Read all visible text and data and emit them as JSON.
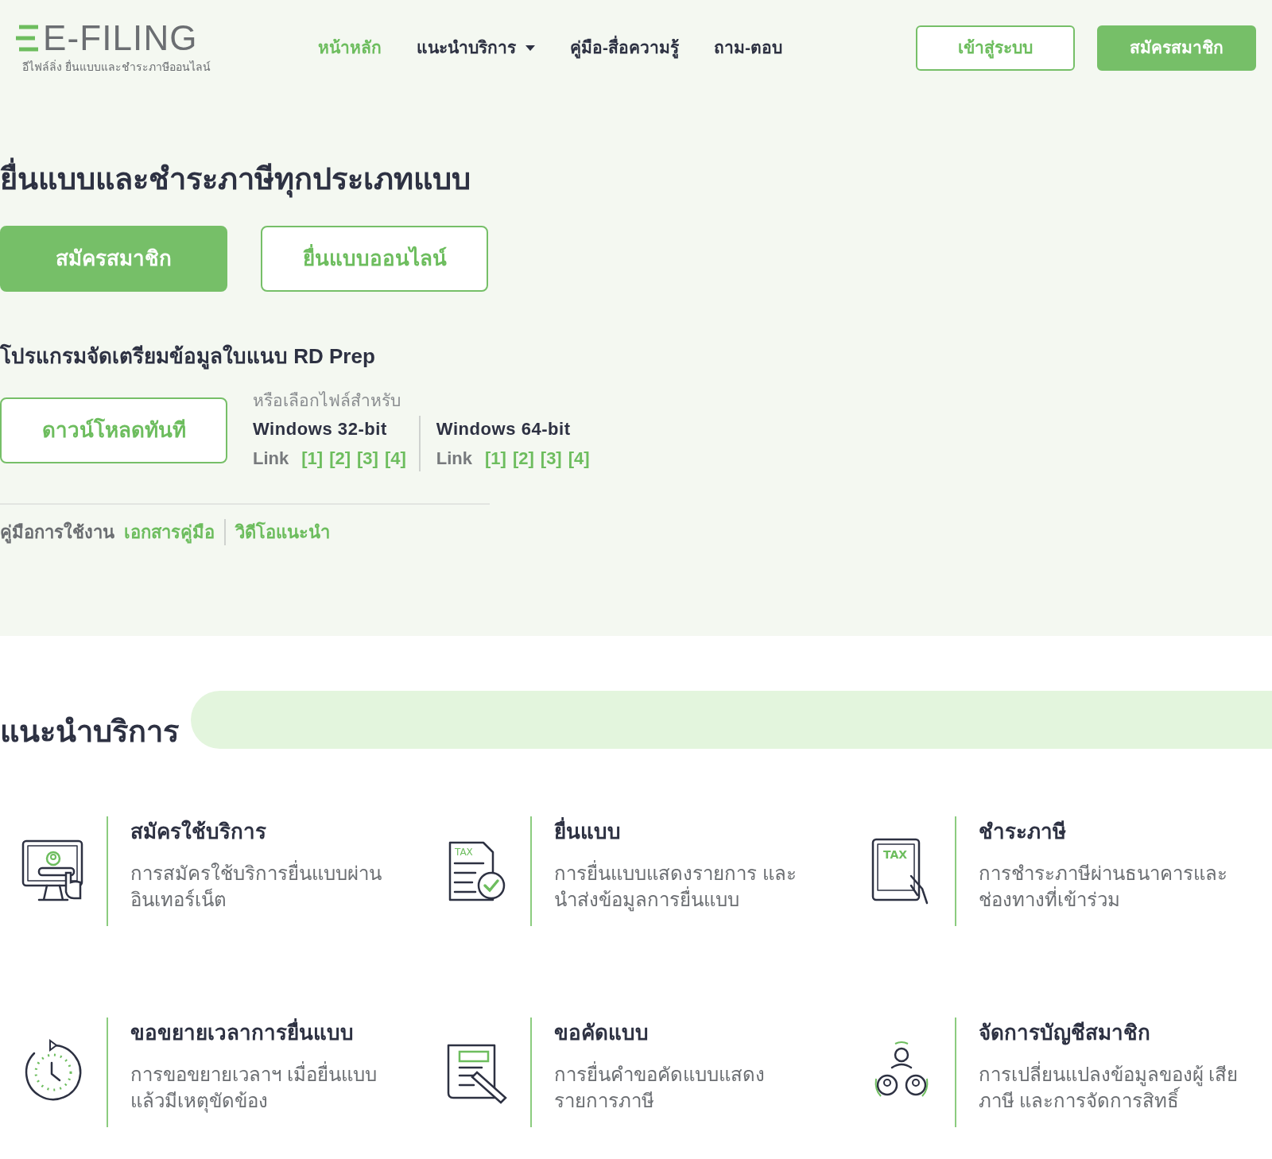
{
  "logo": {
    "wordmark": "E-FILING",
    "tagline": "อีไฟล์ลิ่ง ยื่นแบบและชำระภาษีออนไลน์"
  },
  "nav": [
    {
      "label": "หน้าหลัก",
      "selected": true,
      "dropdown": false
    },
    {
      "label": "แนะนำบริการ",
      "selected": false,
      "dropdown": true
    },
    {
      "label": "คู่มือ-สื่อความรู้",
      "selected": false,
      "dropdown": false
    },
    {
      "label": "ถาม-ตอบ",
      "selected": false,
      "dropdown": false
    }
  ],
  "header_buttons": [
    {
      "label": "เข้าสู่ระบบ",
      "kind": "outline"
    },
    {
      "label": "สมัครสมาชิก",
      "kind": "solid"
    }
  ],
  "hero": {
    "title": "ยื่นแบบและชำระภาษีทุกประเภทแบบ",
    "buttons": [
      {
        "label": "สมัครสมาชิก",
        "kind": "solid"
      },
      {
        "label": "ยื่นแบบออนไลน์",
        "kind": "outline"
      }
    ],
    "rdprep": {
      "title": "โปรแกรมจัดเตรียมข้อมูลใบแนบ RD Prep",
      "download": "ดาวน์โหลดทันที",
      "or_choose": "หรือเลือกไฟล์สำหรับ",
      "platforms": [
        {
          "name": "Windows 32-bit",
          "link_label": "Link",
          "links": [
            "[1]",
            "[2]",
            "[3]",
            "[4]"
          ]
        },
        {
          "name": "Windows 64-bit",
          "link_label": "Link",
          "links": [
            "[1]",
            "[2]",
            "[3]",
            "[4]"
          ]
        }
      ]
    },
    "manual": {
      "label": "คู่มือการใช้งาน",
      "links": [
        "เอกสารคู่มือ",
        "วิดีโอแนะนำ"
      ]
    }
  },
  "services": {
    "title": "แนะนำบริการ",
    "items": [
      {
        "kind": "register",
        "title": "สมัครใช้บริการ",
        "description": "การสมัครใช้บริการยื่นแบบผ่าน อินเทอร์เน็ต"
      },
      {
        "kind": "file",
        "icon_text": "TAX",
        "title": "ยื่นแบบ",
        "description": "การยื่นแบบแสดงรายการ และ นำส่งข้อมูลการยื่นแบบ"
      },
      {
        "kind": "pay",
        "icon_text": "TAX",
        "title": "ชำระภาษี",
        "description": "การชำระภาษีผ่านธนาคารและ ช่องทางที่เข้าร่วม"
      },
      {
        "kind": "extend",
        "title": "ขอขยายเวลาการยื่นแบบ",
        "description": "การขอขยายเวลาฯ เมื่อยื่นแบบ แล้วมีเหตุขัดข้อง"
      },
      {
        "kind": "copy",
        "title": "ขอคัดแบบ",
        "description": "การยื่นคำขอคัดแบบแสดง รายการภาษี"
      },
      {
        "kind": "account",
        "title": "จัดการบัญชีสมาชิก",
        "description": "การเปลี่ยนแปลงข้อมูลของผู้ เสียภาษี และการจัดการสิทธิ์"
      }
    ]
  }
}
